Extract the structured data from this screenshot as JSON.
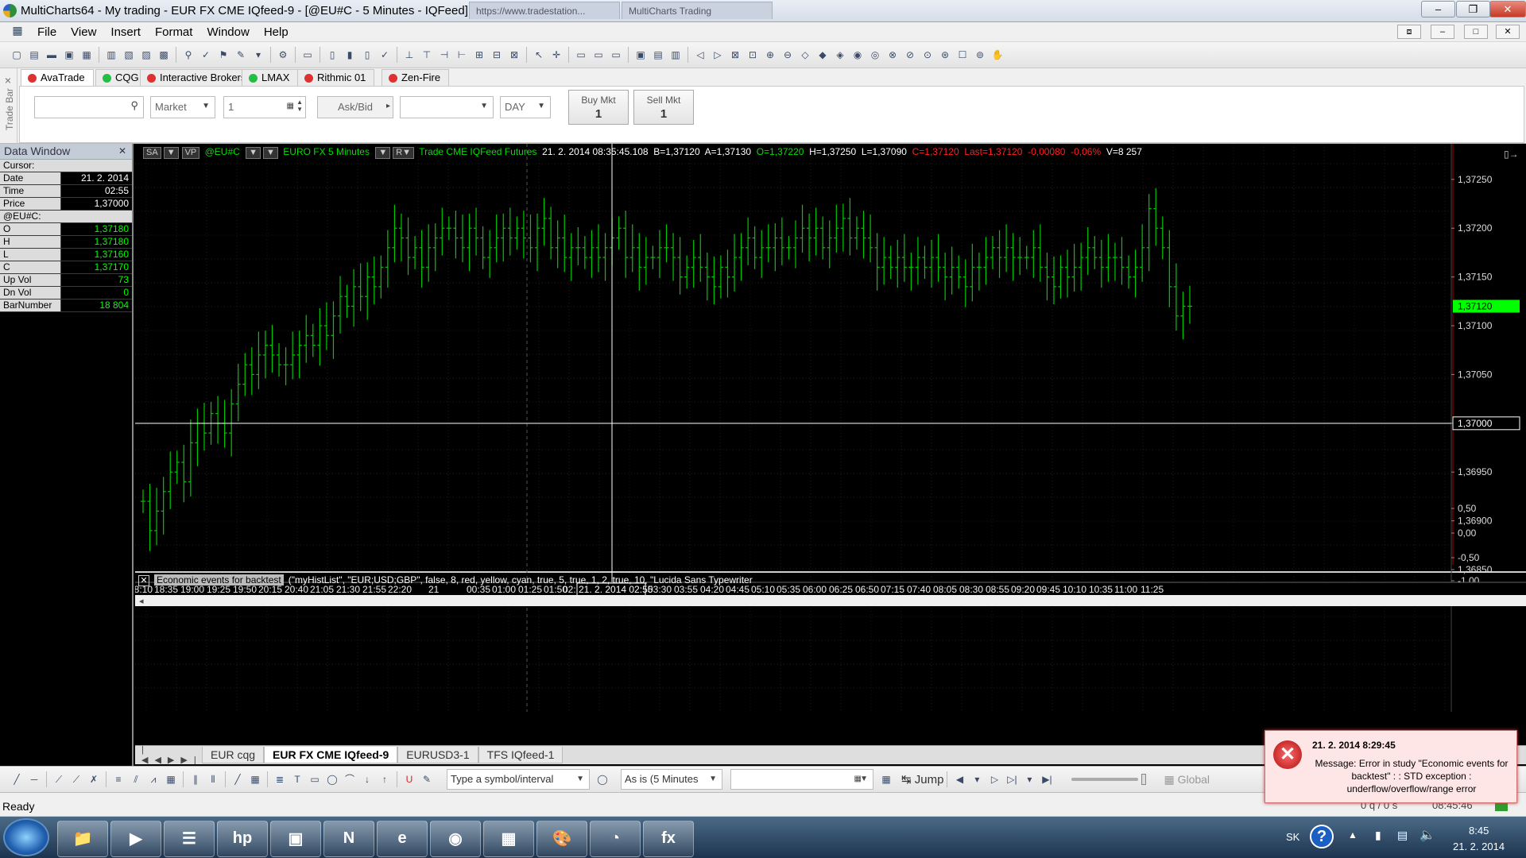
{
  "window": {
    "title": "MultiCharts64 - My trading - EUR FX CME IQfeed-9 - [@EU#C - 5 Minutes - IQFeed]",
    "bg_tabs": [
      "https://www.tradestation...",
      "MultiCharts Trading"
    ]
  },
  "menu": [
    "File",
    "View",
    "Insert",
    "Format",
    "Window",
    "Help"
  ],
  "tradebar": {
    "vertical_label": "Trade Bar",
    "brokers": [
      {
        "label": "AvaTrade",
        "color": "#e03030",
        "active": true
      },
      {
        "label": "CQG",
        "color": "#20c040",
        "active": false
      },
      {
        "label": "Interactive Brokers",
        "color": "#e03030",
        "active": false
      },
      {
        "label": "LMAX",
        "color": "#20c040",
        "active": false
      },
      {
        "label": "Rithmic 01",
        "color": "#e03030",
        "active": false
      },
      {
        "label": "Zen-Fire",
        "color": "#e03030",
        "active": false
      }
    ],
    "order_type": "Market",
    "quantity": "1",
    "ask_bid": "Ask/Bid",
    "tif": "DAY",
    "buy_label": "Buy Mkt",
    "buy_qty": "1",
    "sell_label": "Sell Mkt",
    "sell_qty": "1"
  },
  "datawindow": {
    "title": "Data Window",
    "cursor_label": "Cursor:",
    "rows_top": [
      {
        "k": "Date",
        "v": "21. 2. 2014"
      },
      {
        "k": "Time",
        "v": "02:55"
      },
      {
        "k": "Price",
        "v": "1,37000"
      }
    ],
    "symbol_label": "@EU#C:",
    "rows_sym": [
      {
        "k": "O",
        "v": "1,37180"
      },
      {
        "k": "H",
        "v": "1,37180"
      },
      {
        "k": "L",
        "v": "1,37160"
      },
      {
        "k": "C",
        "v": "1,37170"
      },
      {
        "k": "Up Vol",
        "v": "73"
      },
      {
        "k": "Dn Vol",
        "v": "0"
      },
      {
        "k": "BarNumber",
        "v": "18 804"
      }
    ]
  },
  "chart": {
    "btn_sa": "SA",
    "btn_vp": "VP",
    "symbol": "@EU#C",
    "description": "EURO FX  5 Minutes",
    "meta": "Trade  CME  IQFeed  Futures",
    "datetime": "21. 2. 2014   08:35:45.108",
    "bid": "B=1,37120",
    "ask": "A=1,37130",
    "open": "O=1,37220",
    "high": "H=1,37250",
    "low": "L=1,37090",
    "close": "C=1,37120",
    "last": "Last=1,37120",
    "change": "-0,00080",
    "change_pct": "-0,06%",
    "volume": "V=8 257",
    "price_labels": [
      "1,37250",
      "1,37200",
      "1,37150",
      "1,37100",
      "1,37050",
      "1,37000",
      "1,36950",
      "1,36900",
      "1,36850"
    ],
    "last_price_tag": "1,37120",
    "cursor_price_tag": "1,37000",
    "indicator_name": "Economic events for backtest",
    "indicator_params": "(\"myHistList\",  \"EUR;USD;GBP\",  false,  8,  red,  yellow,  cyan,  true,  5,  true,  1,  2,  true,  10,  \"Lucida Sans Typewriter",
    "sub_labels": [
      "0,50",
      "0,00",
      "-0,50",
      "-1,00"
    ],
    "time_labels": [
      "18:10",
      "18:35",
      "19:00",
      "19:25",
      "19:50",
      "20:15",
      "20:40",
      "21:05",
      "21:30",
      "21:55",
      "22:20",
      "21",
      "00:35",
      "01:00",
      "01:25",
      "01:50",
      "02:",
      "03:30",
      "03:55",
      "04:20",
      "04:45",
      "05:10",
      "05:35",
      "06:00",
      "06:25",
      "06:50",
      "07:15",
      "07:40",
      "08:05",
      "08:30",
      "08:55",
      "09:20",
      "09:45",
      "10:10",
      "10:35",
      "11:00",
      "11:25"
    ],
    "cursor_time_tag": "21. 2. 2014  02:55",
    "colors": {
      "bars": "#00c800",
      "last": "#00ff00",
      "red": "#ff0000",
      "cursor": "#ffffff"
    }
  },
  "chart_data": {
    "type": "bar",
    "title": "EURO FX  5 Minutes",
    "ylim": [
      1.3685,
      1.3728
    ],
    "description": "OHLC close levels (approx) per 5-minute bar",
    "closes": [
      1.3692,
      1.3689,
      1.3691,
      1.3693,
      1.3695,
      1.3696,
      1.3694,
      1.3698,
      1.37,
      1.3699,
      1.3701,
      1.37,
      1.3699,
      1.3702,
      1.3704,
      1.3706,
      1.3705,
      1.3707,
      1.3708,
      1.3707,
      1.3706,
      1.3706,
      1.3707,
      1.3708,
      1.3709,
      1.3708,
      1.371,
      1.3709,
      1.3711,
      1.3713,
      1.3712,
      1.3714,
      1.3713,
      1.3715,
      1.3714,
      1.3716,
      1.3718,
      1.372,
      1.3719,
      1.3717,
      1.3718,
      1.3716,
      1.3718,
      1.3719,
      1.372,
      1.372,
      1.3719,
      1.3718,
      1.372,
      1.3719,
      1.3717,
      1.3718,
      1.3719,
      1.372,
      1.3719,
      1.372,
      1.3719,
      1.3718,
      1.372,
      1.3721,
      1.3718,
      1.3719,
      1.3717,
      1.3718,
      1.3718,
      1.3717,
      1.3718,
      1.3717,
      1.3718,
      1.3719,
      1.372,
      1.3717,
      1.3718,
      1.3716,
      1.3717,
      1.3717,
      1.3718,
      1.3718,
      1.3717,
      1.3715,
      1.3716,
      1.3717,
      1.3716,
      1.3715,
      1.3714,
      1.3716,
      1.3715,
      1.3717,
      1.3718,
      1.3719,
      1.3717,
      1.3718,
      1.3718,
      1.3719,
      1.3718,
      1.3718,
      1.3719,
      1.372,
      1.3719,
      1.372,
      1.3718,
      1.3719,
      1.372,
      1.3721,
      1.3719,
      1.372,
      1.3719,
      1.3718,
      1.3716,
      1.3717,
      1.3716,
      1.3717,
      1.3716,
      1.3716,
      1.3717,
      1.3716,
      1.3717,
      1.3716,
      1.3715,
      1.3716,
      1.3715,
      1.3714,
      1.3716,
      1.3716,
      1.3717,
      1.3718,
      1.3717,
      1.3718,
      1.3717,
      1.3717,
      1.3717,
      1.3718,
      1.3716,
      1.3715,
      1.3714,
      1.3716,
      1.3715,
      1.3716,
      1.3717,
      1.3718,
      1.3717,
      1.3716,
      1.3717,
      1.3717,
      1.3716,
      1.3715,
      1.3716,
      1.3718,
      1.3722,
      1.372,
      1.3718,
      1.3714,
      1.3711,
      1.3712,
      1.3712
    ],
    "last": 1.3712,
    "cursor_price": 1.37
  },
  "bottom_tabs": [
    "EUR cqg",
    "EUR FX CME IQfeed-9",
    "EURUSD3-1",
    "TFS IQfeed-1"
  ],
  "drawbar": {
    "symbol_placeholder": "Type a symbol/interval",
    "resolution": "As is (5 Minutes",
    "jump_label": "Jump",
    "global_label": "Global"
  },
  "status": {
    "text": "Ready",
    "quotes": "0 q / 0 s",
    "time": "08:45:46"
  },
  "popup": {
    "title": "21. 2. 2014 8:29:45",
    "message": "Message: Error in study \"Economic events for backtest\" : : STD exception : underflow/overflow/range error"
  },
  "taskbar": {
    "lang": "SK",
    "clock_time": "8:45",
    "clock_date": "21. 2. 2014"
  }
}
